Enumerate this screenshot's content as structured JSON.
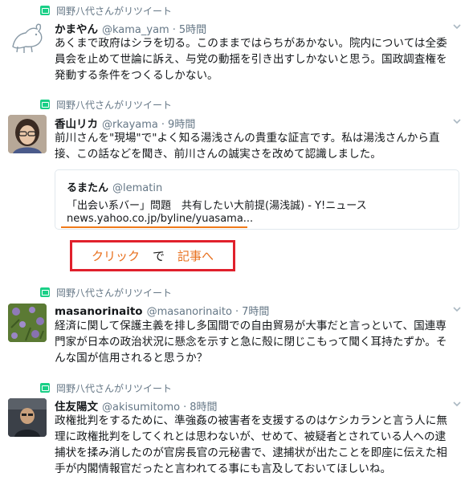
{
  "tweets": [
    {
      "retweet_label": "岡野八代さんがリツイート",
      "name": "かまやん",
      "handle": "@kama_yam",
      "time": "5時間",
      "lines": [
        "あくまで政府はシラを切る。このままではらちがあかない。院内については全委",
        "員会を止めて世論に訴え、与党の動揺を引き出すしかないと思う。国政調査権を",
        "発動する条件をつくるしかない。"
      ]
    },
    {
      "retweet_label": "岡野八代さんがリツイート",
      "name": "香山リカ",
      "handle": "@rkayama",
      "time": "9時間",
      "lines": [
        "前川さんを\"現場\"で\"よく知る湯浅さんの貴重な証言です。私は湯浅さんから直",
        "接、この話などを聞き、前川さんの誠実さを改めて認識しました。"
      ],
      "quote": {
        "name": "るまたん",
        "handle": "@lematin",
        "title": "「出会い系バー」問題　共有したい大前提(湯浅誠) - Y!ニュース",
        "link": "news.yahoo.co.jp/byline/yuasama..."
      }
    },
    {
      "retweet_label": "岡野八代さんがリツイート",
      "name": "masanorinaito",
      "handle": "@masanorinaito",
      "time": "7時間",
      "lines": [
        "経済に関して保護主義を排し多国間での自由貿易が大事だと言っといて、国連専",
        "門家が日本の政治状況に懸念を示すと急に殻に閉じこもって聞く耳持たずか。そ",
        "んな国が信用されると思うか？"
      ]
    },
    {
      "retweet_label": "岡野八代さんがリツイート",
      "name": "住友陽文",
      "handle": "@akisumitomo",
      "time": "8時間",
      "lines": [
        "政権批判をするために、準強姦の被害者を支援するのはケシカランと言う人に無",
        "理に政権批判をしてくれとは思わないが、せめて、被疑者とされている人への逮",
        "捕状を揉み消したのが官房長官の元秘書で、逮捕状が出たことを即座に伝えた相",
        "手が内閣情報官だったと言われてる事にも言及しておいてほしいね。"
      ]
    }
  ],
  "annotation": {
    "click": "クリック",
    "de": "で",
    "article": "記事へ"
  },
  "meta": {
    "separator": "·"
  },
  "colors": {
    "underline": "#f07a1a",
    "box": "#e0202c",
    "annotation_text": "#e8711f",
    "retweet_icon": "#19cf86"
  }
}
